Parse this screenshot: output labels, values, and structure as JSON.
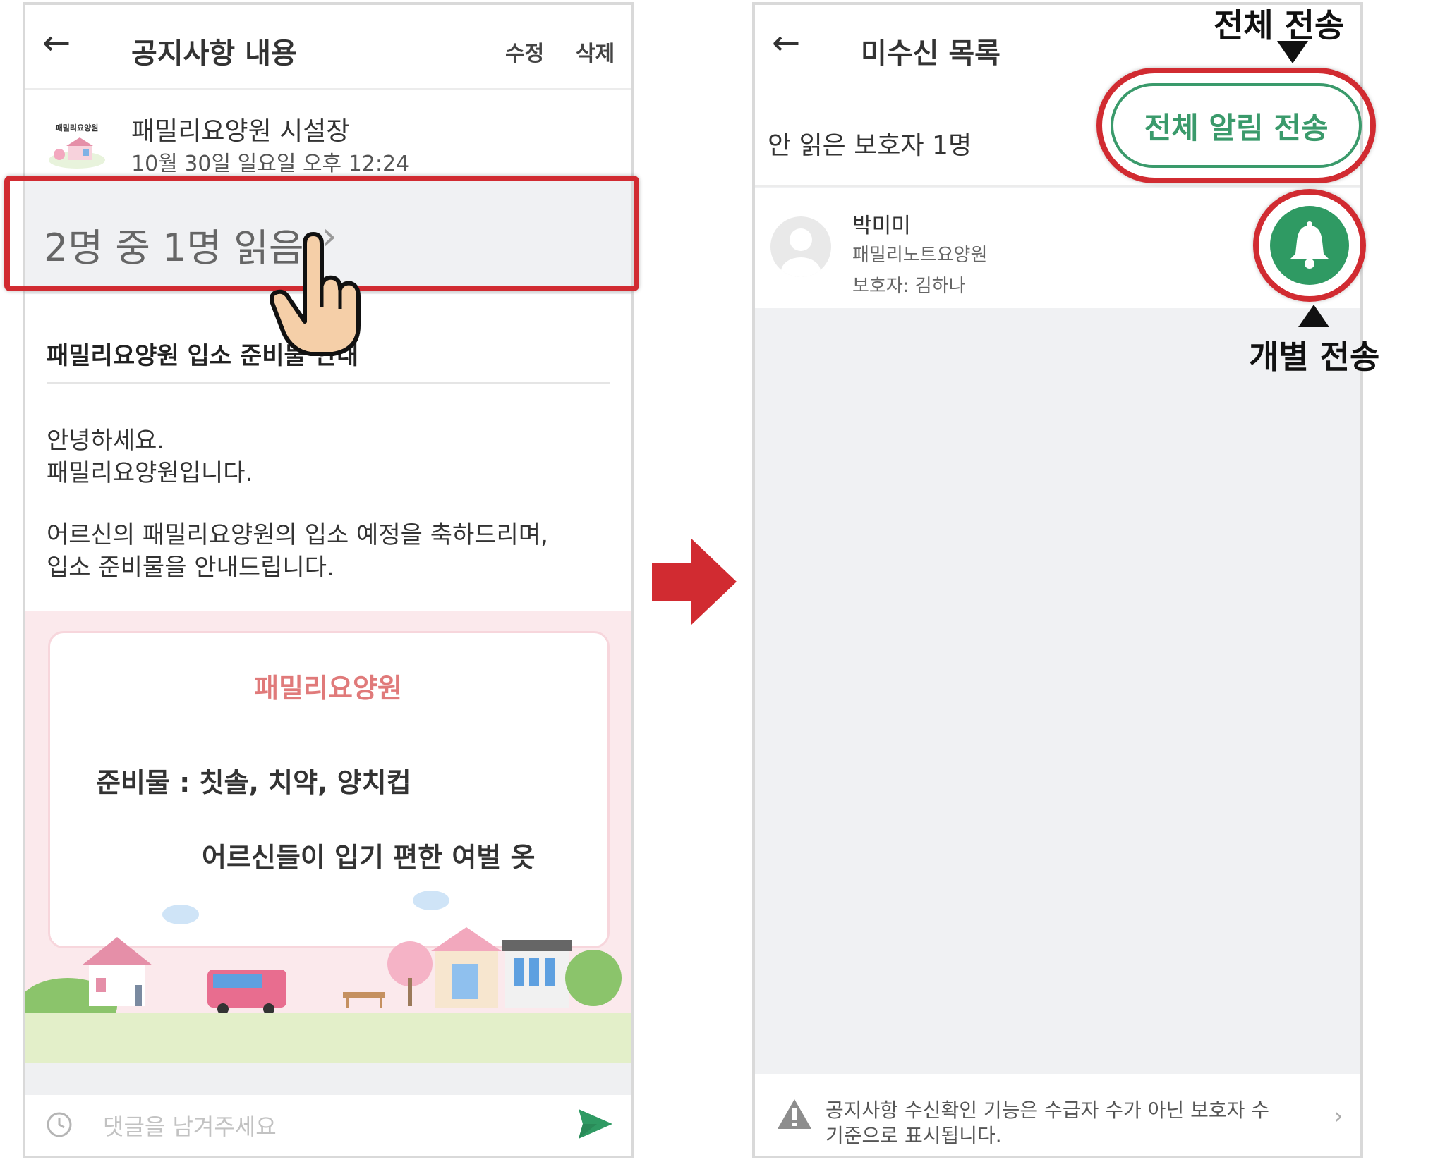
{
  "left_screen": {
    "title": "공지사항 내용",
    "edit_label": "수정",
    "delete_label": "삭제",
    "logo_text": "패밀리요양원",
    "author": "패밀리요양원 시설장",
    "date": "10월 30일 일요일 오후 12:24",
    "read_status": "2명 중 1명 읽음",
    "post_title": "패밀리요양원 입소 준비물 안내",
    "body_lines": [
      "안녕하세요.",
      "패밀리요양원입니다.",
      "어르신의 패밀리요양원의 입소 예정을 축하드리며,",
      "입소 준비물을 안내드립니다."
    ],
    "poster": {
      "title": "패밀리요양원",
      "line1": "준비물 : 칫솔, 치약, 양치컵",
      "line2": "어르신들이 입기 편한 여벌 옷"
    },
    "comment_placeholder": "댓글을 남겨주세요"
  },
  "right_screen": {
    "title": "미수신 목록",
    "unread_count": "안 읽은 보호자 1명",
    "send_all_button": "전체 알림 전송",
    "recipients": [
      {
        "name": "박미미",
        "facility": "패밀리노트요양원",
        "guardian": "보호자: 김하나"
      }
    ],
    "notice_lines": [
      "공지사항 수신확인 기능은 수급자 수가 아닌 보호자 수",
      "기준으로 표시됩니다."
    ]
  },
  "annotations": {
    "send_all": "전체 전송",
    "send_individual": "개별 전송"
  },
  "colors": {
    "highlight": "#d12b31",
    "accent_green": "#3a9a6b",
    "poster_pink": "#fbe9ec"
  }
}
